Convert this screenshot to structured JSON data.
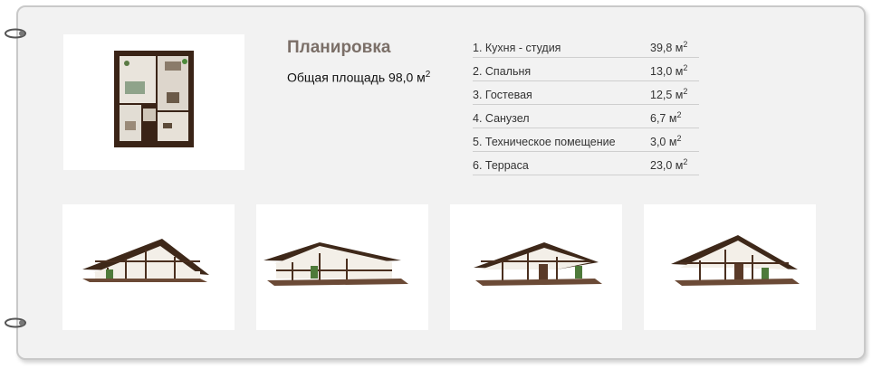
{
  "plan": {
    "heading": "Планировка",
    "total_area_label": "Общая площадь 98,0 м",
    "total_area_sup": "2"
  },
  "rooms": [
    {
      "label": "1. Кухня - студия",
      "area": "39,8 м",
      "sup": "2"
    },
    {
      "label": "2. Спальня",
      "area": "13,0 м",
      "sup": "2"
    },
    {
      "label": "3. Гостевая",
      "area": "12,5 м",
      "sup": "2"
    },
    {
      "label": "4. Санузел",
      "area": "6,7 м",
      "sup": "2"
    },
    {
      "label": "5. Техническое помещение",
      "area": "3,0 м",
      "sup": "2"
    },
    {
      "label": "6. Терраса",
      "area": "23,0 м",
      "sup": "2"
    }
  ],
  "renders": [
    "view-1",
    "view-2",
    "view-3",
    "view-4"
  ],
  "colors": {
    "card_bg": "#f2f2f2",
    "heading": "#7b6f68",
    "roof": "#4a2f1f",
    "divider": "#cfcfcf"
  }
}
